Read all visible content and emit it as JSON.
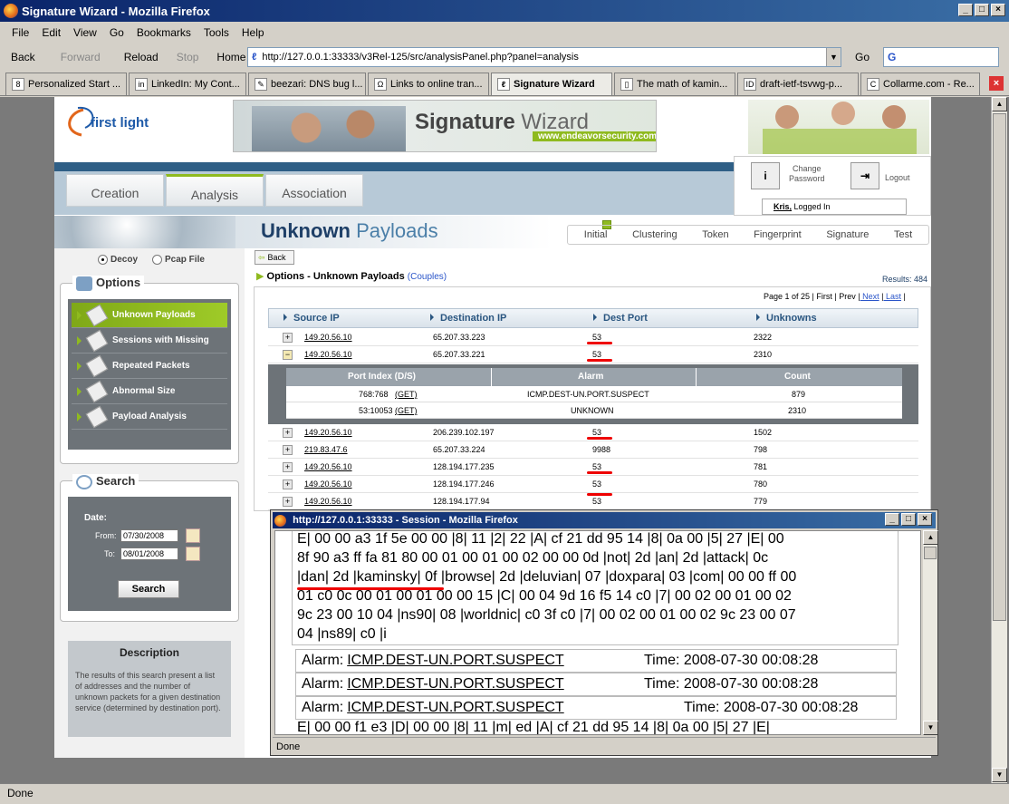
{
  "window": {
    "title": "Signature Wizard - Mozilla Firefox"
  },
  "menu": [
    "File",
    "Edit",
    "View",
    "Go",
    "Bookmarks",
    "Tools",
    "Help"
  ],
  "nav": {
    "back": "Back",
    "forward": "Forward",
    "reload": "Reload",
    "stop": "Stop",
    "home": "Home",
    "url": "http://127.0.0.1:33333/v3Rel-125/src/analysisPanel.php?panel=analysis",
    "go": "Go",
    "search_logo": "G"
  },
  "tabs": [
    {
      "icon": "8",
      "label": "Personalized Start ..."
    },
    {
      "icon": "in",
      "label": "LinkedIn: My Cont..."
    },
    {
      "icon": "✎",
      "label": "beezari: DNS bug l..."
    },
    {
      "icon": "Ω",
      "label": "Links to online tran..."
    },
    {
      "icon": "ℓ",
      "label": "Signature Wizard"
    },
    {
      "icon": "▯",
      "label": "The math of kamin..."
    },
    {
      "icon": "ID",
      "label": "draft-ietf-tsvwg-p..."
    },
    {
      "icon": "C",
      "label": "Collarme.com - Re..."
    }
  ],
  "header": {
    "logo": "first light",
    "banner_title_a": "Signature",
    "banner_title_b": " Wizard",
    "banner_url": "www.endeavorsecurity.com"
  },
  "navtabs": [
    "Creation",
    "Analysis",
    "Association"
  ],
  "user": {
    "change_password_1": "Change",
    "change_password_2": "Password",
    "logout": "Logout",
    "user_name": "Kris,",
    "logged_in": " Logged In"
  },
  "page": {
    "title_a": "Unknown",
    "title_b": " Payloads"
  },
  "steps": [
    "Initial",
    "Clustering",
    "Token",
    "Fingerprint",
    "Signature",
    "Test"
  ],
  "sidebar": {
    "decoy": "Decoy",
    "pcap": "Pcap File",
    "options_title": "Options",
    "options": [
      "Unknown Payloads",
      "Sessions with Missing",
      "Repeated Packets",
      "Abnormal Size",
      "Payload Analysis"
    ],
    "search_title": "Search",
    "date_label": "Date:",
    "from_label": "From:",
    "to_label": "To:",
    "from_value": "07/30/2008",
    "to_value": "08/01/2008",
    "search_button": "Search",
    "desc_title": "Description",
    "desc_text": "The results of this search present a list of addresses and the number of unknown packets for a given destination service (determined by destination port)."
  },
  "results": {
    "back": "Back",
    "heading": "Options - Unknown Payloads",
    "couples": "(Couples)",
    "count_label": "Results: 484",
    "pagination": {
      "page": "Page 1 of 25 |",
      "first": " First |",
      "prev": " Prev |",
      "next": " Next",
      "sep": " |",
      "last": " Last",
      "end": " |"
    },
    "columns": [
      "Source IP",
      "Destination IP",
      "Dest Port",
      "Unknowns"
    ],
    "rows": [
      {
        "toggle": "+",
        "src": "149.20.56.10",
        "dst": "65.207.33.223",
        "port": "53",
        "unknowns": "2322"
      },
      {
        "toggle": "−",
        "src": "149.20.56.10",
        "dst": "65.207.33.221",
        "port": "53",
        "unknowns": "2310"
      },
      {
        "toggle": "+",
        "src": "149.20.56.10",
        "dst": "206.239.102.197",
        "port": "53",
        "unknowns": "1502"
      },
      {
        "toggle": "+",
        "src": "219.83.47.6",
        "dst": "65.207.33.224",
        "port": "9988",
        "unknowns": "798"
      },
      {
        "toggle": "+",
        "src": "149.20.56.10",
        "dst": "128.194.177.235",
        "port": "53",
        "unknowns": "781"
      },
      {
        "toggle": "+",
        "src": "149.20.56.10",
        "dst": "128.194.177.246",
        "port": "53",
        "unknowns": "780"
      },
      {
        "toggle": "+",
        "src": "149.20.56.10",
        "dst": "128.194.177.94",
        "port": "53",
        "unknowns": "779"
      }
    ],
    "subgrid": {
      "columns": [
        "Port Index (D/S)",
        "Alarm",
        "Count"
      ],
      "rows": [
        {
          "index": "768:768",
          "get": "(GET)",
          "alarm": "ICMP.DEST-UN.PORT.SUSPECT",
          "count": "879"
        },
        {
          "index": "53:10053",
          "get": "(GET)",
          "alarm": "UNKNOWN",
          "count": "2310"
        }
      ]
    }
  },
  "popup": {
    "title": "http://127.0.0.1:33333 - Session - Mozilla Firefox",
    "hex_lines": [
      "E| 00 00 a3 1f 5e 00 00 |8| 11 |2| 22 |A| cf 21 dd 95 14 |8| 0a 00 |5| 27 |E| 00",
      "8f 90 a3 ff fa 81 80 00 01 00 01 00 02 00 00 0d |not| 2d |an| 2d |attack| 0c",
      "|dan| 2d |kaminsky| 0f |browse| 2d |deluvian| 07 |doxpara| 03 |com| 00 00 ff 00",
      "01 c0 0c 00 01 00 01 00 00 15 |C| 00 04 9d 16 f5 14 c0 |7| 00 02 00 01 00 02",
      "9c 23 00 10 04 |ns90| 08 |worldnic| c0 3f c0 |7| 00 02 00 01 00 02 9c 23 00 07",
      "04 |ns89| c0 |i"
    ],
    "alarms": [
      {
        "label": "Alarm:",
        "name": "ICMP.DEST-UN.PORT.SUSPECT",
        "time_label": "Time:",
        "time": "2008-07-30 00:08:28"
      },
      {
        "label": "Alarm:",
        "name": "ICMP.DEST-UN.PORT.SUSPECT",
        "time_label": "Time:",
        "time": "2008-07-30 00:08:28"
      },
      {
        "label": "Alarm:",
        "name": "ICMP.DEST-UN.PORT.SUSPECT",
        "time_label": "Time:",
        "time": "2008-07-30 00:08:28"
      }
    ],
    "tail_line": "E| 00 00 f1 e3 |D| 00 00 |8| 11 |m| ed |A| cf 21 dd 95 14 |8| 0a 00 |5| 27 |E|",
    "status": "Done"
  },
  "status": "Done",
  "colors": {
    "accent": "#8fba1f",
    "titlebar": "#0a246a",
    "highlight": "#e00000"
  }
}
